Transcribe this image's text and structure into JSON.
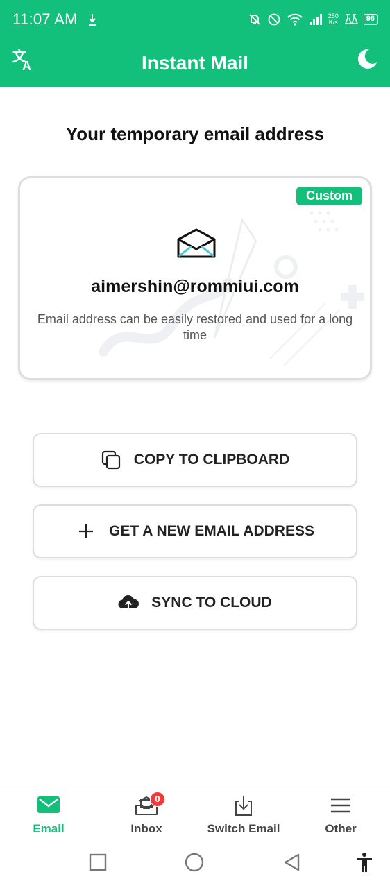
{
  "status_bar": {
    "time": "11:07 AM",
    "speed_top": "250",
    "speed_bottom": "K/s",
    "battery": "96"
  },
  "app": {
    "title": "Instant Mail",
    "left_icon": "translate-icon",
    "right_icon": "moon-icon",
    "accent_color": "#13c07b"
  },
  "page": {
    "heading": "Your temporary email address"
  },
  "email_card": {
    "badge": "Custom",
    "icon": "envelope-open-icon",
    "address": "aimershin@rommiui.com",
    "note": "Email address can be easily restored and used for a long time"
  },
  "actions": {
    "copy": {
      "label": "COPY TO CLIPBOARD",
      "icon": "copy-icon"
    },
    "new": {
      "label": "GET A NEW EMAIL ADDRESS",
      "icon": "plus-icon"
    },
    "sync": {
      "label": "SYNC TO CLOUD",
      "icon": "cloud-upload-icon"
    }
  },
  "bottom_nav": {
    "email": {
      "label": "Email",
      "active": true
    },
    "inbox": {
      "label": "Inbox",
      "badge": "0"
    },
    "switch": {
      "label": "Switch Email"
    },
    "other": {
      "label": "Other"
    }
  },
  "colors": {
    "badge_red": "#ef3b3b",
    "text_dark": "#111111"
  }
}
